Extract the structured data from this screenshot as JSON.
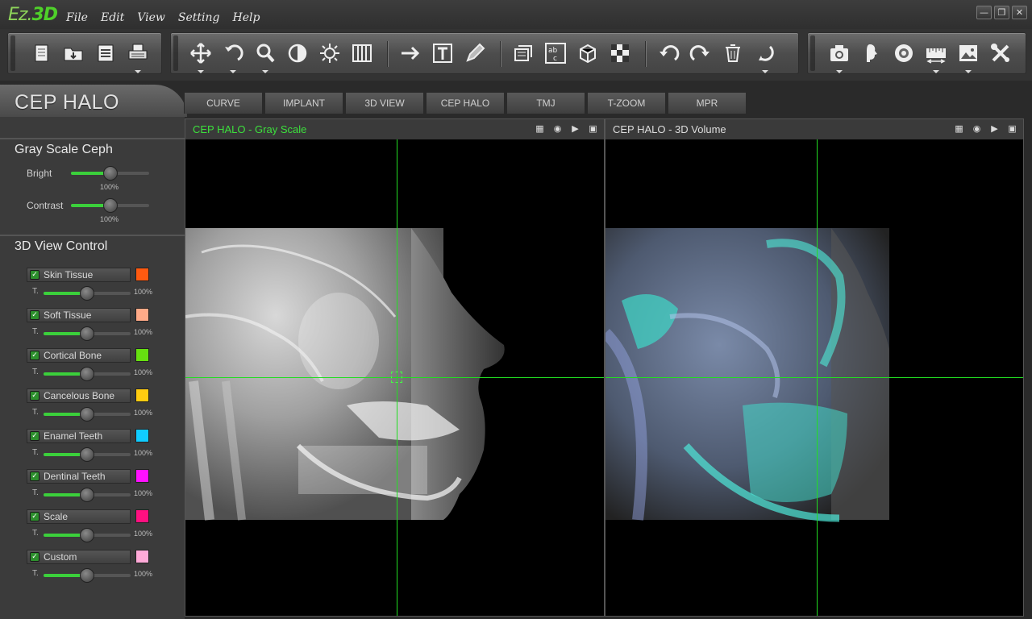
{
  "app": {
    "logo_ez": "Ez.",
    "logo_3d": "3D",
    "menu": [
      "File",
      "Edit",
      "View",
      "Setting",
      "Help"
    ],
    "window_controls": [
      "minimize",
      "restore",
      "close"
    ]
  },
  "toolbar": {
    "groups": [
      [
        "new-icon",
        "open-icon",
        "save-icon",
        "print-icon"
      ],
      [
        "pan-icon",
        "rotate-icon",
        "zoom-icon",
        "contrast-icon",
        "brightness-icon",
        "columns-icon",
        "arrow-icon",
        "text-icon",
        "pencil-icon",
        "layer-icon",
        "abc-icon",
        "cube-icon",
        "checker-icon",
        "undo-icon",
        "redo-icon",
        "trash-icon",
        "reset-icon"
      ],
      [
        "camera-icon",
        "person-icon",
        "disc-icon",
        "measure-icon",
        "image-icon",
        "tools-icon"
      ]
    ]
  },
  "module": {
    "title": "CEP HALO",
    "tabs": [
      "CURVE",
      "IMPLANT",
      "3D VIEW",
      "CEP HALO",
      "TMJ",
      "T-ZOOM",
      "MPR"
    ]
  },
  "gray_scale": {
    "title": "Gray Scale Ceph",
    "bright_label": "Bright",
    "bright_value": "100%",
    "bright_level": 0.5,
    "contrast_label": "Contrast",
    "contrast_value": "100%",
    "contrast_level": 0.5
  },
  "view_control": {
    "title": "3D View Control",
    "t_label": "T.",
    "layers": [
      {
        "name": "Skin Tissue",
        "color": "#ff5a10",
        "value": "100%",
        "level": 0.5
      },
      {
        "name": "Soft Tissue",
        "color": "#ffaa88",
        "value": "100%",
        "level": 0.5
      },
      {
        "name": "Cortical Bone",
        "color": "#66e010",
        "value": "100%",
        "level": 0.5
      },
      {
        "name": "Cancelous Bone",
        "color": "#ffcc10",
        "value": "100%",
        "level": 0.5
      },
      {
        "name": "Enamel Teeth",
        "color": "#10ccff",
        "value": "100%",
        "level": 0.5
      },
      {
        "name": "Dentinal Teeth",
        "color": "#ff10ff",
        "value": "100%",
        "level": 0.5
      },
      {
        "name": "Scale",
        "color": "#ff1080",
        "value": "100%",
        "level": 0.5
      },
      {
        "name": "Custom",
        "color": "#ffaad8",
        "value": "100%",
        "level": 0.5
      }
    ]
  },
  "viewports": {
    "left_title": "CEP HALO - Gray Scale",
    "left_title_color": "#3ce03c",
    "right_title": "CEP HALO - 3D Volume",
    "right_title_color": "#dddddd",
    "crosshair_color": "#22dd22"
  }
}
